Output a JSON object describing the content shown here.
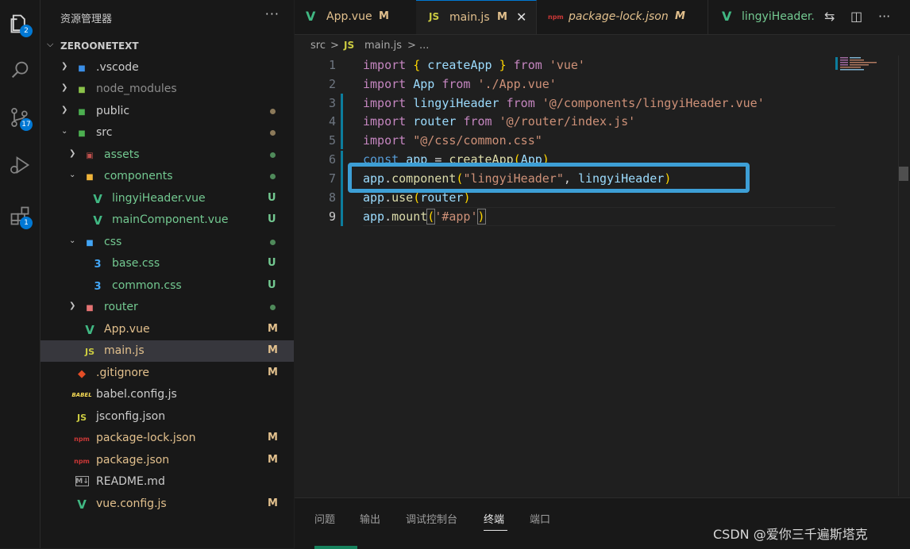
{
  "activity_bar": {
    "items": [
      {
        "icon": "explorer-icon",
        "badge": "2"
      },
      {
        "icon": "search-icon",
        "badge": ""
      },
      {
        "icon": "source-control-icon",
        "badge": "17"
      },
      {
        "icon": "run-debug-icon",
        "badge": ""
      },
      {
        "icon": "extensions-icon",
        "badge": "1"
      }
    ]
  },
  "sidebar": {
    "title": "资源管理器",
    "more": "···",
    "folder": "ZEROONETEXT",
    "tree": [
      {
        "name": ".vscode",
        "status": "",
        "color": "#cccccc"
      },
      {
        "name": "node_modules",
        "status": "",
        "color": "#8c8c8c"
      },
      {
        "name": "public",
        "status": "•",
        "color": "#cccccc"
      },
      {
        "name": "src",
        "status": "•",
        "color": "#cccccc"
      },
      {
        "name": "assets",
        "status": "•",
        "color": "#73c991"
      },
      {
        "name": "components",
        "status": "•",
        "color": "#73c991"
      },
      {
        "name": "lingyiHeader.vue",
        "status": "U",
        "color": "#73c991"
      },
      {
        "name": "mainComponent.vue",
        "status": "U",
        "color": "#73c991"
      },
      {
        "name": "css",
        "status": "•",
        "color": "#73c991"
      },
      {
        "name": "base.css",
        "status": "U",
        "color": "#73c991"
      },
      {
        "name": "common.css",
        "status": "U",
        "color": "#73c991"
      },
      {
        "name": "router",
        "status": "•",
        "color": "#73c991"
      },
      {
        "name": "App.vue",
        "status": "M",
        "color": "#e2c08d"
      },
      {
        "name": "main.js",
        "status": "M",
        "color": "#e2c08d"
      },
      {
        "name": ".gitignore",
        "status": "M",
        "color": "#e2c08d"
      },
      {
        "name": "babel.config.js",
        "status": "",
        "color": "#cccccc"
      },
      {
        "name": "jsconfig.json",
        "status": "",
        "color": "#cccccc"
      },
      {
        "name": "package-lock.json",
        "status": "M",
        "color": "#e2c08d"
      },
      {
        "name": "package.json",
        "status": "M",
        "color": "#e2c08d"
      },
      {
        "name": "README.md",
        "status": "",
        "color": "#cccccc"
      },
      {
        "name": "vue.config.js",
        "status": "M",
        "color": "#e2c08d"
      }
    ]
  },
  "tabs": [
    {
      "name": "App.vue",
      "mod": "M",
      "icon": "V"
    },
    {
      "name": "main.js",
      "mod": "M",
      "icon": "JS",
      "close": "✕"
    },
    {
      "name": "package-lock.json",
      "mod": "M",
      "icon": "npm"
    },
    {
      "name": "lingyiHeader.",
      "mod": "",
      "icon": "V"
    }
  ],
  "breadcrumb": {
    "folder": "src",
    "sep": ">",
    "icon": "JS",
    "file": "main.js",
    "sep2": ">",
    "more": "..."
  },
  "code": {
    "line_numbers": [
      "1",
      "2",
      "3",
      "4",
      "5",
      "6",
      "7",
      "8",
      "9"
    ],
    "l1": {
      "a": "import",
      "b": "{",
      "c": "createApp",
      "d": "}",
      "e": "from",
      "f": "'vue'"
    },
    "l2": {
      "a": "import",
      "b": "App",
      "c": "from",
      "d": "'./App.vue'"
    },
    "l3": {
      "a": "import",
      "b": "lingyiHeader",
      "c": "from",
      "d": "'@/components/lingyiHeader.vue'"
    },
    "l4": {
      "a": "import",
      "b": "router",
      "c": "from",
      "d": "'@/router/index.js'"
    },
    "l5": {
      "a": "import",
      "b": "\"@/css/common.css\""
    },
    "l6": {
      "a": "const",
      "b": "app",
      "c": "=",
      "d": "createApp",
      "e": "(",
      "f": "App",
      "g": ")"
    },
    "l7": {
      "a": "app",
      "b": ".",
      "c": "component",
      "d": "(",
      "e": "\"lingyiHeader\"",
      "f": ",",
      "g": "lingyiHeader",
      "h": ")"
    },
    "l8": {
      "a": "app",
      "b": ".",
      "c": "use",
      "d": "(",
      "e": "router",
      "f": ")"
    },
    "l9": {
      "a": "app",
      "b": ".",
      "c": "mount",
      "d": "(",
      "e": "'#app'",
      "f": ")"
    }
  },
  "panel": {
    "tabs": [
      "问题",
      "输出",
      "调试控制台",
      "终端",
      "端口"
    ],
    "active": "终端"
  },
  "watermark": "CSDN @爱你三千遍斯塔克",
  "colors": {
    "accent": "#0078d4",
    "highlight_box": "#3d9fd6",
    "modified": "#e2c08d",
    "untracked": "#73c991"
  }
}
